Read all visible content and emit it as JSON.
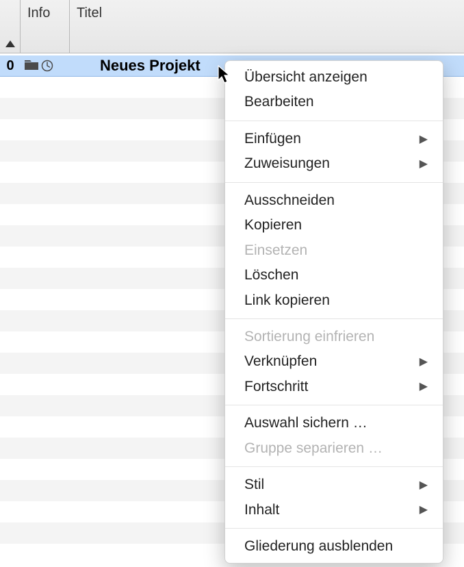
{
  "header": {
    "info": "Info",
    "title": "Titel"
  },
  "row": {
    "index": "0",
    "title": "Neues Projekt"
  },
  "menu": {
    "show_overview": "Übersicht anzeigen",
    "edit": "Bearbeiten",
    "insert": "Einfügen",
    "assignments": "Zuweisungen",
    "cut": "Ausschneiden",
    "copy": "Kopieren",
    "paste": "Einsetzen",
    "delete": "Löschen",
    "copy_link": "Link kopieren",
    "freeze_sort": "Sortierung einfrieren",
    "link": "Verknüpfen",
    "progress": "Fortschritt",
    "save_selection": "Auswahl sichern …",
    "separate_group": "Gruppe separieren …",
    "style": "Stil",
    "content": "Inhalt",
    "hide_outline": "Gliederung ausblenden"
  }
}
